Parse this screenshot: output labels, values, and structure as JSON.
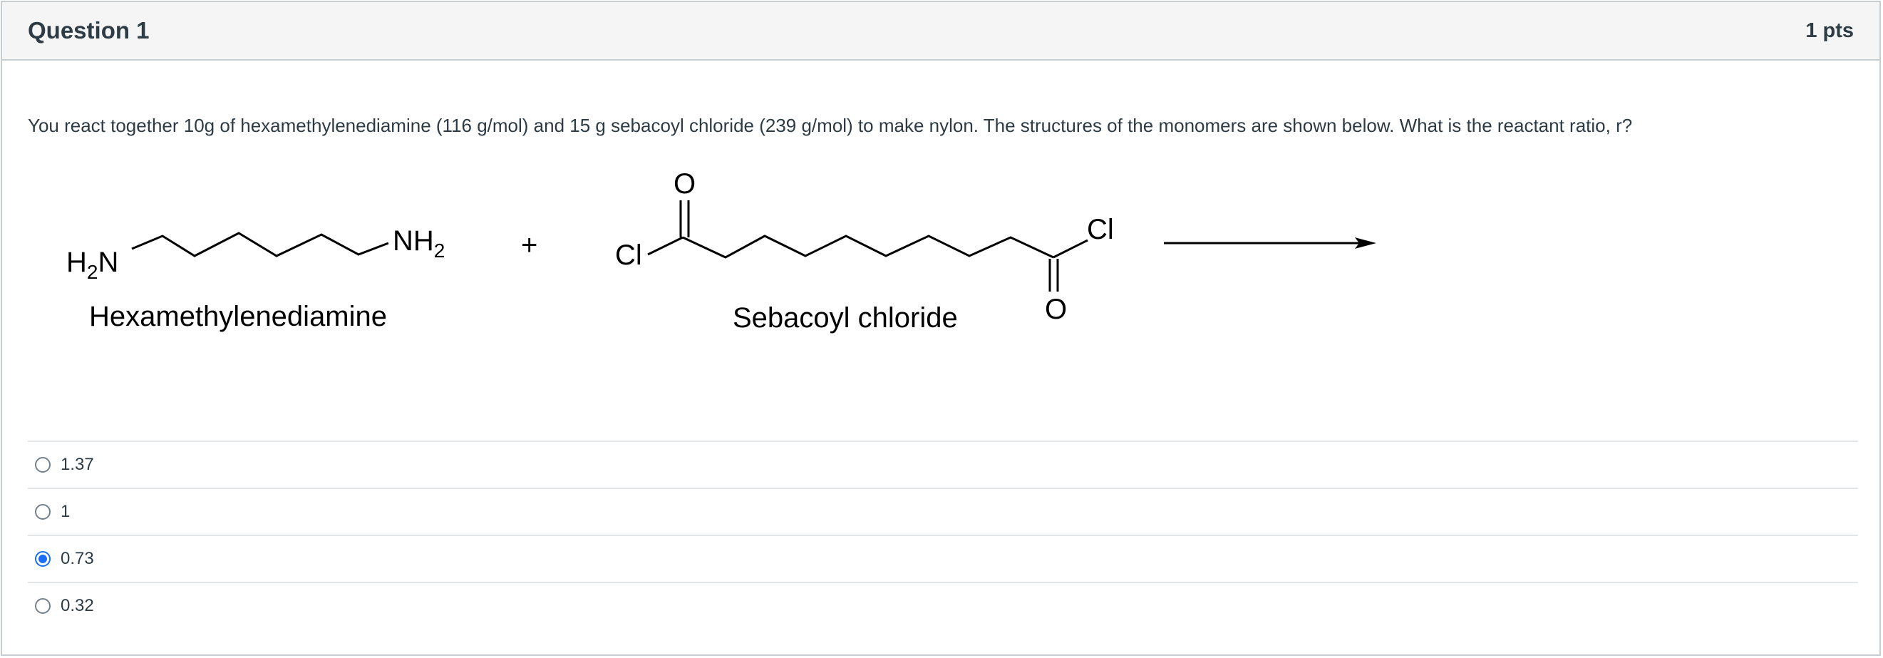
{
  "question": {
    "title": "Question 1",
    "points": "1 pts",
    "text": "You react together 10g of hexamethylenediamine (116 g/mol) and 15 g sebacoyl chloride (239 g/mol) to make nylon. The structures of the monomers are shown below. What is the reactant ratio, r?"
  },
  "figure": {
    "h2n": "H",
    "h2n_sub": "2",
    "h2n_n": "N",
    "nh2": "NH",
    "nh2_sub": "2",
    "plus": "+",
    "cl_left": "Cl",
    "cl_right": "Cl",
    "o_top": "O",
    "o_bottom": "O",
    "label_left": "Hexamethylenediamine",
    "label_right": "Sebacoyl chloride"
  },
  "answers": [
    {
      "label": "1.37",
      "selected": false
    },
    {
      "label": "1",
      "selected": false
    },
    {
      "label": "0.73",
      "selected": true
    },
    {
      "label": "0.32",
      "selected": false
    }
  ],
  "colors": {
    "accent": "#1a6ef3",
    "header_bg": "#f5f5f5",
    "border": "#c7cdd1",
    "text": "#2d3b45"
  }
}
